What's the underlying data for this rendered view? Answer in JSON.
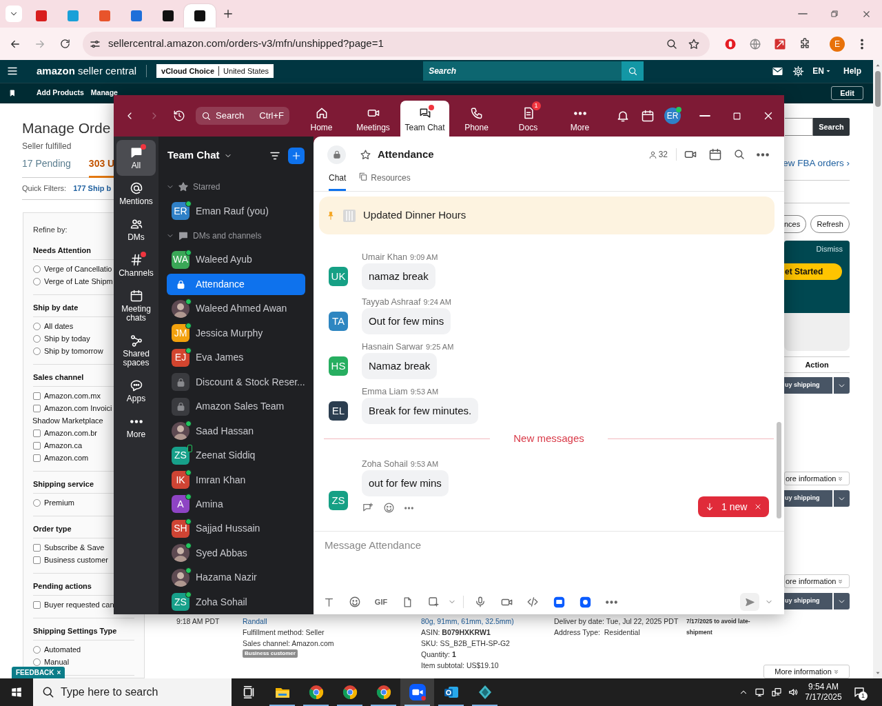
{
  "browser": {
    "tabs": [
      {
        "color": "#d81e1e",
        "selected": false
      },
      {
        "color": "#1aa0d8",
        "selected": false
      },
      {
        "color": "#e8542b",
        "selected": false
      },
      {
        "color": "#1e6fd9",
        "selected": false
      },
      {
        "color": "#111111",
        "selected": false
      },
      {
        "color": "#111111",
        "selected": true
      }
    ],
    "url": "sellercentral.amazon.com/orders-v3/mfn/unshipped?page=1",
    "extensions": [
      {
        "kind": "stop"
      },
      {
        "kind": "globe"
      },
      {
        "kind": "pdf"
      },
      {
        "kind": "puzzle"
      }
    ],
    "profile": "E"
  },
  "seller_central": {
    "logo": "**amazon** seller central",
    "store": "vCloud Choice",
    "marketplace": "United States",
    "search_placeholder": "Search",
    "language": "EN",
    "help": "Help",
    "nav": [
      "Add Products",
      "Manage"
    ],
    "edit_button": "Edit"
  },
  "orders_page": {
    "title": "Manage Orde",
    "subtitle": "Seller fulfilled",
    "tabs": [
      {
        "label": "17 Pending",
        "selected": false
      },
      {
        "label": "303 U",
        "selected": true
      }
    ],
    "quick_filters_label": "Quick Filters:",
    "quick_filters": [
      "177 Ship b"
    ],
    "refine": {
      "title": "Refine by:",
      "sections": [
        {
          "title": "Needs Attention",
          "options": [
            {
              "kind": "radio",
              "label": "Verge of Cancellatio",
              "checked": false
            },
            {
              "kind": "radio",
              "label": "Verge of Late Shipm",
              "checked": false
            }
          ]
        },
        {
          "title": "Ship by date",
          "options": [
            {
              "kind": "radio",
              "label": "All dates",
              "checked": false
            },
            {
              "kind": "radio",
              "label": "Ship by today",
              "checked": false
            },
            {
              "kind": "radio",
              "label": "Ship by tomorrow",
              "checked": false
            }
          ]
        },
        {
          "title": "Sales channel",
          "options": [
            {
              "kind": "checkbox",
              "label": "Amazon.com.mx",
              "checked": false
            },
            {
              "kind": "checkbox",
              "label": "Amazon.com Invoici",
              "continuation": "Shadow Marketplace",
              "checked": false
            },
            {
              "kind": "checkbox",
              "label": "Amazon.com.br",
              "checked": false
            },
            {
              "kind": "checkbox",
              "label": "Amazon.ca",
              "checked": false
            },
            {
              "kind": "checkbox",
              "label": "Amazon.com",
              "checked": false
            }
          ]
        },
        {
          "title": "Shipping service",
          "options": [
            {
              "kind": "radio",
              "label": "Premium",
              "checked": false
            }
          ]
        },
        {
          "title": "Order type",
          "options": [
            {
              "kind": "checkbox",
              "label": "Subscribe & Save",
              "checked": false
            },
            {
              "kind": "checkbox",
              "label": "Business customer",
              "checked": false
            }
          ]
        },
        {
          "title": "Pending actions",
          "options": [
            {
              "kind": "checkbox",
              "label": "Buyer requested can",
              "checked": false
            }
          ]
        },
        {
          "title": "Shipping Settings Type",
          "options": [
            {
              "kind": "radio",
              "label": "Automated",
              "checked": false
            },
            {
              "kind": "radio",
              "label": "Manual",
              "checked": false
            }
          ]
        }
      ]
    },
    "search_button": "Search",
    "fba_link": "ew FBA orders ›",
    "preferences_button": "nces",
    "refresh_button": "Refresh",
    "banner": {
      "dismiss": "Dismiss",
      "cta": "et Started"
    },
    "action_header": "Action",
    "actions": [
      {
        "buy": "uy shipping"
      },
      {
        "more": "ore information",
        "buy": "uy shipping"
      },
      {
        "more": "ore information",
        "buy": "uy shipping"
      },
      {
        "more": "More information"
      }
    ],
    "order": {
      "time": "9:18 AM PDT",
      "buyer": "Randall",
      "fulfillment": "Fulfillment method: Seller",
      "channel": "Sales channel: Amazon.com",
      "badge": "Business customer",
      "product": "80g, 91mm, 61mm, 32.5mm)",
      "asin": "ASIN: **B079HXKRW1**",
      "sku": "SKU: SS_B2B_ETH-SP-G2",
      "quantity": "Quantity: **1**",
      "subtotal": "Item subtotal: US$19.10",
      "deliver_by": "Deliver by date: Tue, Jul 22, 2025 PDT",
      "address_type": "Address Type:  Residential",
      "ship_note": "7/17/2025 to avoid late-shipment"
    },
    "feedback": "FEEDBACK",
    "feedback_close": "×"
  },
  "zoom": {
    "search": "Search",
    "shortcut": "Ctrl+F",
    "tabs": [
      {
        "kind": "home",
        "label": "Home",
        "selected": false,
        "dot": false
      },
      {
        "kind": "video",
        "label": "Meetings",
        "selected": false,
        "dot": false
      },
      {
        "kind": "chat",
        "label": "Team Chat",
        "selected": true,
        "dot": true
      },
      {
        "kind": "phone",
        "label": "Phone",
        "selected": false,
        "dot": false
      },
      {
        "kind": "doc",
        "label": "Docs",
        "selected": false,
        "dot": false,
        "badge": "1"
      },
      {
        "kind": "more",
        "label": "More",
        "selected": false,
        "dot": false
      }
    ],
    "user": {
      "initials": "ER",
      "online": true
    },
    "rail": [
      {
        "kind": "chat",
        "label": "All",
        "selected": true,
        "dot": true
      },
      {
        "kind": "at",
        "label": "Mentions",
        "selected": false,
        "dot": false
      },
      {
        "kind": "people",
        "label": "DMs",
        "selected": false,
        "dot": false
      },
      {
        "kind": "hash",
        "label": "Channels",
        "selected": false,
        "dot": true
      },
      {
        "kind": "calendar",
        "label": "Meeting chats",
        "selected": false,
        "dot": false
      },
      {
        "kind": "share",
        "label": "Shared spaces",
        "selected": false,
        "dot": false
      },
      {
        "kind": "apps",
        "label": "Apps",
        "selected": false,
        "dot": false
      },
      {
        "kind": "more",
        "label": "More",
        "selected": false,
        "dot": false
      }
    ],
    "list_title": "Team Chat",
    "sections": [
      {
        "kind": "star",
        "title": "Starred",
        "expanded": true,
        "items": [
          {
            "name": "Eman Rauf (you)",
            "kind": "initials",
            "initials": "ER",
            "color": "#2f80c7",
            "online": true,
            "mobile": false,
            "selected": false
          }
        ]
      },
      {
        "kind": "chat",
        "title": "DMs and channels",
        "expanded": true,
        "items": [
          {
            "name": "Waleed Ayub",
            "kind": "initials",
            "initials": "WA",
            "color": "#3aa757",
            "online": true,
            "mobile": false,
            "selected": false
          },
          {
            "name": "Attendance",
            "kind": "lock",
            "online": false,
            "mobile": false,
            "selected": true
          },
          {
            "name": "Waleed Ahmed Awan",
            "kind": "photo",
            "online": true,
            "mobile": false,
            "selected": false
          },
          {
            "name": "Jessica Murphy",
            "kind": "initials",
            "initials": "JM",
            "color": "#f3a10d",
            "online": true,
            "mobile": false,
            "selected": false
          },
          {
            "name": "Eva James",
            "kind": "initials",
            "initials": "EJ",
            "color": "#d2452f",
            "online": true,
            "mobile": false,
            "selected": false
          },
          {
            "name": "Discount & Stock Reser...",
            "kind": "lock",
            "online": false,
            "mobile": false,
            "selected": false
          },
          {
            "name": "Amazon Sales Team",
            "kind": "lock",
            "online": false,
            "mobile": false,
            "selected": false
          },
          {
            "name": "Saad Hassan",
            "kind": "photo",
            "online": true,
            "mobile": false,
            "selected": false
          },
          {
            "name": "Zeenat Siddiq",
            "kind": "initials",
            "initials": "ZS",
            "color": "#17a08a",
            "online": false,
            "mobile": true,
            "selected": false
          },
          {
            "name": "Imran Khan",
            "kind": "initials",
            "initials": "IK",
            "color": "#cf4434",
            "online": true,
            "mobile": false,
            "selected": false
          },
          {
            "name": "Amina",
            "kind": "initials",
            "initials": "A",
            "color": "#8e44c4",
            "online": true,
            "mobile": false,
            "selected": false
          },
          {
            "name": "Sajjad Hussain",
            "kind": "initials",
            "initials": "SH",
            "color": "#cf4434",
            "online": true,
            "mobile": false,
            "selected": false
          },
          {
            "name": "Syed Abbas",
            "kind": "photo",
            "online": true,
            "mobile": false,
            "selected": false
          },
          {
            "name": "Hazama Nazir",
            "kind": "photo",
            "online": true,
            "mobile": false,
            "selected": false
          },
          {
            "name": "Zoha Sohail",
            "kind": "initials",
            "initials": "ZS",
            "color": "#17a08a",
            "online": true,
            "mobile": false,
            "selected": false
          }
        ]
      }
    ],
    "chat": {
      "title": "Attendance",
      "starred": false,
      "members": "32",
      "tabs": [
        {
          "label": "Chat",
          "selected": true
        },
        {
          "label": "Resources",
          "selected": false
        }
      ],
      "pinned": "Updated Dinner Hours",
      "messages": [
        {
          "kind": "message",
          "sender": "Umair Khan",
          "time": "9:09 AM",
          "initials": "UK",
          "color": "#16a085",
          "text": "namaz break"
        },
        {
          "kind": "message",
          "sender": "Tayyab Ashraaf",
          "time": "9:24 AM",
          "initials": "TA",
          "color": "#2e86c1",
          "text": "Out for few mins"
        },
        {
          "kind": "message",
          "sender": "Hasnain Sarwar",
          "time": "9:25 AM",
          "initials": "HS",
          "color": "#27ae60",
          "text": "Namaz break"
        },
        {
          "kind": "message",
          "sender": "Emma Liam",
          "time": "9:53 AM",
          "initials": "EL",
          "color": "#2c3e50",
          "text": "Break for few minutes."
        },
        {
          "kind": "divider",
          "text": "New messages"
        },
        {
          "kind": "message",
          "sender": "Zoha Sohail",
          "time": "9:53 AM",
          "initials": "ZS",
          "color": "#16a085",
          "text": "out for few mins"
        }
      ],
      "new_pill": "1 new",
      "composer": {
        "placeholder": "Message Attendance",
        "gif": "GIF"
      }
    }
  },
  "taskbar": {
    "search_placeholder": "Type here to search",
    "apps": [
      {
        "kind": "task_view"
      },
      {
        "kind": "folder",
        "running": true,
        "selected": false
      },
      {
        "kind": "browser",
        "running": true,
        "selected": false
      },
      {
        "kind": "browser",
        "running": true,
        "selected": false
      },
      {
        "kind": "browser",
        "running": true,
        "selected": false
      },
      {
        "kind": "zoom",
        "running": true,
        "selected": true
      },
      {
        "kind": "mail",
        "running": true,
        "selected": false
      },
      {
        "kind": "diamond",
        "running": true,
        "selected": false
      }
    ],
    "time": "9:54 AM",
    "date": "7/17/2025",
    "notifications": "1"
  }
}
